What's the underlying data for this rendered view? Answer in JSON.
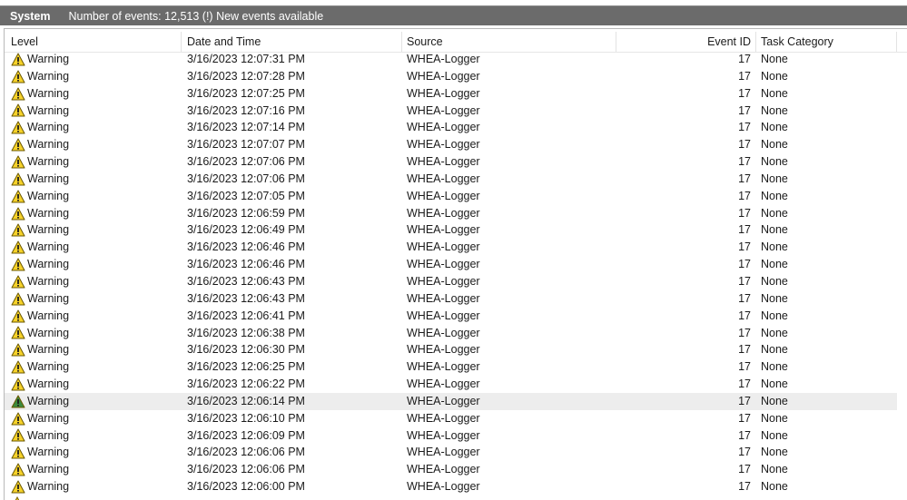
{
  "titlebar": {
    "log_name": "System",
    "event_count": "Number of events: 12,513 (!) New events available"
  },
  "columns": {
    "level": "Level",
    "date_time": "Date and Time",
    "source": "Source",
    "event_id": "Event ID",
    "task_category": "Task Category"
  },
  "colors": {
    "titlebar_bg": "#6b6b6b",
    "warning_fill": "#f6d22a",
    "warning_outline": "#7a6200",
    "selected_row": "#ededed",
    "selected_icon_fill": "#3c8a3c"
  },
  "icons": {
    "warning": "warning-triangle-icon"
  },
  "rows": [
    {
      "level": "Warning",
      "datetime": "3/16/2023 12:07:31 PM",
      "source": "WHEA-Logger",
      "event_id": "17",
      "task_category": "None"
    },
    {
      "level": "Warning",
      "datetime": "3/16/2023 12:07:28 PM",
      "source": "WHEA-Logger",
      "event_id": "17",
      "task_category": "None"
    },
    {
      "level": "Warning",
      "datetime": "3/16/2023 12:07:25 PM",
      "source": "WHEA-Logger",
      "event_id": "17",
      "task_category": "None"
    },
    {
      "level": "Warning",
      "datetime": "3/16/2023 12:07:16 PM",
      "source": "WHEA-Logger",
      "event_id": "17",
      "task_category": "None"
    },
    {
      "level": "Warning",
      "datetime": "3/16/2023 12:07:14 PM",
      "source": "WHEA-Logger",
      "event_id": "17",
      "task_category": "None"
    },
    {
      "level": "Warning",
      "datetime": "3/16/2023 12:07:07 PM",
      "source": "WHEA-Logger",
      "event_id": "17",
      "task_category": "None"
    },
    {
      "level": "Warning",
      "datetime": "3/16/2023 12:07:06 PM",
      "source": "WHEA-Logger",
      "event_id": "17",
      "task_category": "None"
    },
    {
      "level": "Warning",
      "datetime": "3/16/2023 12:07:06 PM",
      "source": "WHEA-Logger",
      "event_id": "17",
      "task_category": "None"
    },
    {
      "level": "Warning",
      "datetime": "3/16/2023 12:07:05 PM",
      "source": "WHEA-Logger",
      "event_id": "17",
      "task_category": "None"
    },
    {
      "level": "Warning",
      "datetime": "3/16/2023 12:06:59 PM",
      "source": "WHEA-Logger",
      "event_id": "17",
      "task_category": "None"
    },
    {
      "level": "Warning",
      "datetime": "3/16/2023 12:06:49 PM",
      "source": "WHEA-Logger",
      "event_id": "17",
      "task_category": "None"
    },
    {
      "level": "Warning",
      "datetime": "3/16/2023 12:06:46 PM",
      "source": "WHEA-Logger",
      "event_id": "17",
      "task_category": "None"
    },
    {
      "level": "Warning",
      "datetime": "3/16/2023 12:06:46 PM",
      "source": "WHEA-Logger",
      "event_id": "17",
      "task_category": "None"
    },
    {
      "level": "Warning",
      "datetime": "3/16/2023 12:06:43 PM",
      "source": "WHEA-Logger",
      "event_id": "17",
      "task_category": "None"
    },
    {
      "level": "Warning",
      "datetime": "3/16/2023 12:06:43 PM",
      "source": "WHEA-Logger",
      "event_id": "17",
      "task_category": "None"
    },
    {
      "level": "Warning",
      "datetime": "3/16/2023 12:06:41 PM",
      "source": "WHEA-Logger",
      "event_id": "17",
      "task_category": "None"
    },
    {
      "level": "Warning",
      "datetime": "3/16/2023 12:06:38 PM",
      "source": "WHEA-Logger",
      "event_id": "17",
      "task_category": "None"
    },
    {
      "level": "Warning",
      "datetime": "3/16/2023 12:06:30 PM",
      "source": "WHEA-Logger",
      "event_id": "17",
      "task_category": "None"
    },
    {
      "level": "Warning",
      "datetime": "3/16/2023 12:06:25 PM",
      "source": "WHEA-Logger",
      "event_id": "17",
      "task_category": "None"
    },
    {
      "level": "Warning",
      "datetime": "3/16/2023 12:06:22 PM",
      "source": "WHEA-Logger",
      "event_id": "17",
      "task_category": "None"
    },
    {
      "level": "Warning",
      "datetime": "3/16/2023 12:06:14 PM",
      "source": "WHEA-Logger",
      "event_id": "17",
      "task_category": "None",
      "selected": true
    },
    {
      "level": "Warning",
      "datetime": "3/16/2023 12:06:10 PM",
      "source": "WHEA-Logger",
      "event_id": "17",
      "task_category": "None"
    },
    {
      "level": "Warning",
      "datetime": "3/16/2023 12:06:09 PM",
      "source": "WHEA-Logger",
      "event_id": "17",
      "task_category": "None"
    },
    {
      "level": "Warning",
      "datetime": "3/16/2023 12:06:06 PM",
      "source": "WHEA-Logger",
      "event_id": "17",
      "task_category": "None"
    },
    {
      "level": "Warning",
      "datetime": "3/16/2023 12:06:06 PM",
      "source": "WHEA-Logger",
      "event_id": "17",
      "task_category": "None"
    },
    {
      "level": "Warning",
      "datetime": "3/16/2023 12:06:00 PM",
      "source": "WHEA-Logger",
      "event_id": "17",
      "task_category": "None"
    }
  ]
}
